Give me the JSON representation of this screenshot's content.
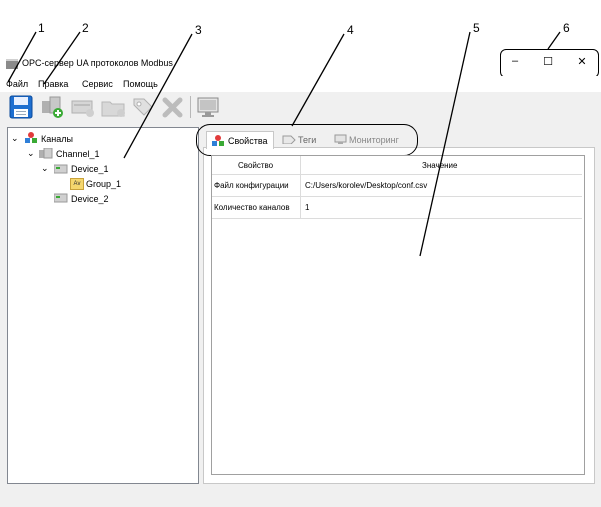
{
  "window": {
    "title": "OPC-сервер UA протоколов Modbus",
    "controls": {
      "minimize": "–",
      "maximize": "☐",
      "close": "✕"
    }
  },
  "menu": {
    "items": [
      "Файл",
      "Правка",
      "Сервис",
      "Помощь"
    ]
  },
  "toolbar": {
    "buttons": [
      "save-icon",
      "add-channel-icon",
      "add-device-icon",
      "add-group-icon",
      "add-tag-icon",
      "delete-icon",
      "monitor-icon"
    ]
  },
  "tree": {
    "root": "Каналы",
    "channel": "Channel_1",
    "device1": "Device_1",
    "group1": "Group_1",
    "device2": "Device_2",
    "group_icon_text": "Av"
  },
  "tabs": {
    "properties": "Свойства",
    "tags": "Теги",
    "monitoring": "Мониторинг"
  },
  "grid": {
    "headers": [
      "Свойство",
      "Значение"
    ],
    "rows": [
      [
        "Файл конфигурации",
        "C:/Users/korolev/Desktop/conf.csv"
      ],
      [
        "Количество каналов",
        "1"
      ]
    ]
  },
  "callouts": [
    "1",
    "2",
    "3",
    "4",
    "5",
    "6"
  ],
  "colors": {
    "save_blue": "#1e6fd0",
    "delete_gray": "#bcbcbc",
    "tree_border": "#828790"
  }
}
